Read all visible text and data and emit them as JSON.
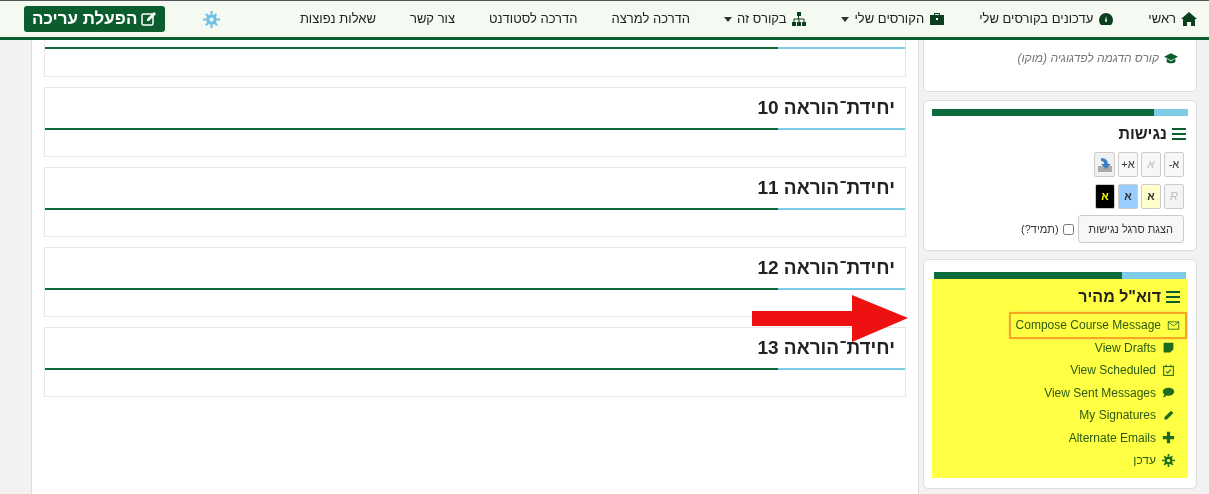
{
  "nav": {
    "items": [
      {
        "label": "ראשי",
        "kind": "home",
        "dropdown": false
      },
      {
        "label": "עדכונים בקורסים שלי",
        "kind": "dashboard",
        "dropdown": false
      },
      {
        "label": "הקורסים שלי",
        "kind": "briefcase",
        "dropdown": true
      },
      {
        "label": "בקורס זה",
        "kind": "sitemap",
        "dropdown": true
      },
      {
        "label": "הדרכה למרצה",
        "kind": "plain",
        "dropdown": false
      },
      {
        "label": "הדרכה לסטודנט",
        "kind": "plain",
        "dropdown": false
      },
      {
        "label": "צור קשר",
        "kind": "plain",
        "dropdown": false
      },
      {
        "label": "שאלות נפוצות",
        "kind": "plain",
        "dropdown": false
      }
    ],
    "edit_button": "הפעלת עריכה"
  },
  "sections": [
    {
      "title": "יחידת־הוראה 10"
    },
    {
      "title": "יחידת־הוראה 11"
    },
    {
      "title": "יחידת־הוראה 12"
    },
    {
      "title": "יחידת־הוראה 13"
    }
  ],
  "sidebar": {
    "course_link": "קורס הדגמה לפדגוגיה (מוקו)",
    "accessibility": {
      "title": "נגישות",
      "size_buttons": [
        {
          "label": "א-",
          "disabled": false
        },
        {
          "label": "א",
          "disabled": true
        },
        {
          "label": "א+",
          "disabled": false
        }
      ],
      "color_buttons": [
        {
          "label": "R",
          "disabled": true,
          "kind": "reset",
          "color": "#f4f4f4"
        },
        {
          "label": "א",
          "disabled": false,
          "kind": "light",
          "color": "#ffffcc"
        },
        {
          "label": "א",
          "disabled": false,
          "kind": "light",
          "color": "#99ccff"
        },
        {
          "label": "א",
          "disabled": false,
          "kind": "dark",
          "color": "#000000"
        }
      ],
      "toolbar_button": "הצגת סרגל נגישות",
      "always": {
        "label": "(תמיד?)",
        "checked": false
      }
    },
    "quickmail": {
      "title": "דוא\"ל מהיר",
      "highlighted": true,
      "items": [
        {
          "label": "Compose Course Message",
          "kind": "envelope",
          "selected": true
        },
        {
          "label": "View Drafts",
          "kind": "note",
          "selected": false
        },
        {
          "label": "View Scheduled",
          "kind": "calendar",
          "selected": false
        },
        {
          "label": "View Sent Messages",
          "kind": "comment",
          "selected": false
        },
        {
          "label": "My Signatures",
          "kind": "pencil",
          "selected": false
        },
        {
          "label": "Alternate Emails",
          "kind": "plus",
          "selected": false
        },
        {
          "label": "עדכן",
          "kind": "gear",
          "selected": false
        }
      ]
    }
  }
}
